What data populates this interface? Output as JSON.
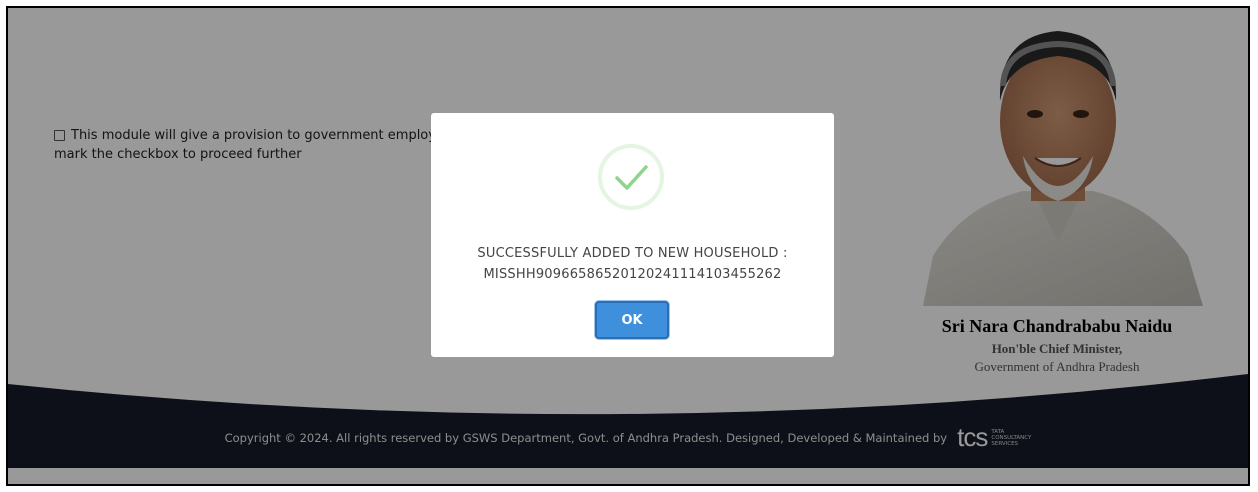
{
  "consent": {
    "line1": "This module will give a provision to government employ",
    "line2": "mark the checkbox to proceed further"
  },
  "chief_minister": {
    "name": "Sri Nara Chandrababu Naidu",
    "role": "Hon'ble Chief Minister,",
    "government": "Government of Andhra Pradesh"
  },
  "footer": {
    "copyright": "Copyright © 2024. All rights reserved by GSWS Department, Govt. of Andhra Pradesh. Designed, Developed & Maintained by",
    "logo_text": "tcs",
    "logo_small_1": "TATA",
    "logo_small_2": "CONSULTANCY",
    "logo_small_3": "SERVICES"
  },
  "modal": {
    "icon": "success-check-icon",
    "message_line1": "SUCCESSFULLY ADDED TO NEW HOUSEHOLD :",
    "message_line2": "MISSHH909665865201202411141034552​62",
    "ok_label": "OK"
  },
  "colors": {
    "footer_bg": "#171c28",
    "ok_button": "#3e8fdc",
    "success_green": "#8fd48c"
  }
}
